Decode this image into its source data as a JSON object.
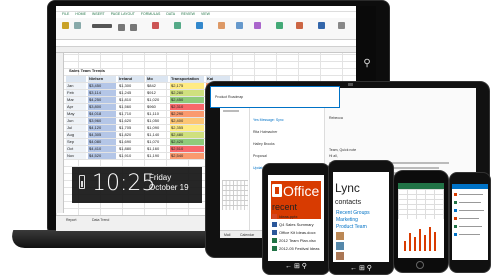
{
  "laptop": {
    "excel": {
      "ribbon_tabs": [
        "FILE",
        "HOME",
        "INSERT",
        "PAGE LAYOUT",
        "FORMULAS",
        "DATA",
        "REVIEW",
        "VIEW"
      ],
      "table_title": "Sales Team Trends",
      "headers": [
        "",
        "Nielsen",
        "Ireland",
        "Mo",
        "Transportation",
        "Kai"
      ],
      "rows": [
        [
          "Jan",
          "$3,450",
          "$1,300",
          "$842",
          "$2,175",
          "$1,204"
        ],
        [
          "Feb",
          "$3,114",
          "$1,245",
          "$912",
          "$2,280",
          "$1,155"
        ],
        [
          "Mar",
          "$4,250",
          "$1,810",
          "$1,020",
          "$2,450",
          "$1,290"
        ],
        [
          "Apr",
          "$3,800",
          "$1,560",
          "$960",
          "$2,310",
          "$1,240"
        ],
        [
          "May",
          "$4,018",
          "$1,710",
          "$1,110",
          "$2,290",
          "$1,330"
        ],
        [
          "Jun",
          "$3,960",
          "$1,620",
          "$1,050",
          "$2,400",
          "$1,280"
        ],
        [
          "Jul",
          "$4,120",
          "$1,705",
          "$1,090",
          "$2,355",
          "$1,310"
        ],
        [
          "Aug",
          "$4,305",
          "$1,820",
          "$1,140",
          "$2,480",
          "$1,350"
        ],
        [
          "Sep",
          "$4,080",
          "$1,690",
          "$1,070",
          "$2,420",
          "$1,300"
        ],
        [
          "Oct",
          "$4,410",
          "$1,880",
          "$1,160",
          "$2,510",
          "$1,370"
        ],
        [
          "Nov",
          "$4,520",
          "$1,910",
          "$1,190",
          "$2,540",
          "$1,390"
        ]
      ],
      "sheet_tabs": [
        "Report",
        "Data Trend"
      ]
    },
    "lockscreen": {
      "time": "10:25",
      "day": "Friday",
      "date": "October 19"
    },
    "charms": [
      "search-icon",
      "share-icon",
      "start-icon"
    ]
  },
  "tablet": {
    "outlook": {
      "popup_text": "Product Roadmap",
      "list_items": [
        "Yes Message: Sync",
        "Rita Hutmacher",
        "Hailey Brooks",
        "Proposal",
        "Update for Q3 Business Review"
      ],
      "reading_header": "Rebecca",
      "reading_lines": [
        "Team, Quick note",
        "Hi all,"
      ],
      "bottom_nav": [
        "Mail",
        "Calendar",
        "People",
        "Tasks"
      ]
    }
  },
  "phones": {
    "office": {
      "title": "Office",
      "section": "recent",
      "files": [
        "Ideas.pptx",
        "Q4 Sales Summary",
        "Office Kit Ideas.docx",
        "2012 Team Plan.xlsx",
        "2012-05 Festival Ideas"
      ]
    },
    "lync": {
      "title": "Lync",
      "section": "contacts",
      "groups": [
        "Recent Groups",
        "Marketing",
        "Product Team"
      ]
    }
  },
  "colors": {
    "excel_green": "#217346",
    "office_orange": "#d83b01",
    "outlook_blue": "#0072c6"
  }
}
